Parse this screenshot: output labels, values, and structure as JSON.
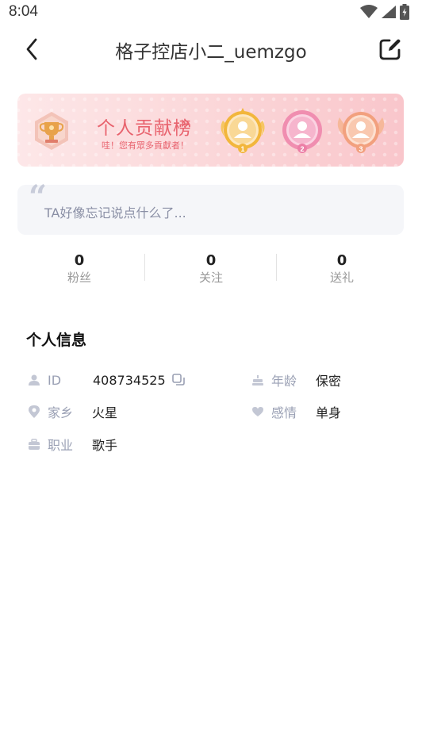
{
  "status_bar": {
    "time": "8:04"
  },
  "nav": {
    "title": "格子控店小二_uemzgo"
  },
  "rank_banner": {
    "title": "个人贡献榜",
    "chevron": "»",
    "subtitle": "哇！您有眾多貢獻者！",
    "medals": [
      "1",
      "2",
      "3"
    ]
  },
  "signature": {
    "quote": "“",
    "text": "TA好像忘记说点什么了..."
  },
  "stats": [
    {
      "value": "0",
      "label": "粉丝"
    },
    {
      "value": "0",
      "label": "关注"
    },
    {
      "value": "0",
      "label": "送礼"
    }
  ],
  "personal_info": {
    "title": "个人信息",
    "id": {
      "label": "ID",
      "value": "408734525"
    },
    "age": {
      "label": "年龄",
      "value": "保密"
    },
    "hometown": {
      "label": "家乡",
      "value": "火星"
    },
    "relationship": {
      "label": "感情",
      "value": "单身"
    },
    "job": {
      "label": "职业",
      "value": "歌手"
    }
  },
  "colors": {
    "accent": "#e8636e",
    "icon_gray": "#c3c7d4",
    "label_gray": "#9aa0b4",
    "gold": "#f2b63c",
    "pink": "#ec7ea6",
    "bronze": "#f2a07e"
  }
}
